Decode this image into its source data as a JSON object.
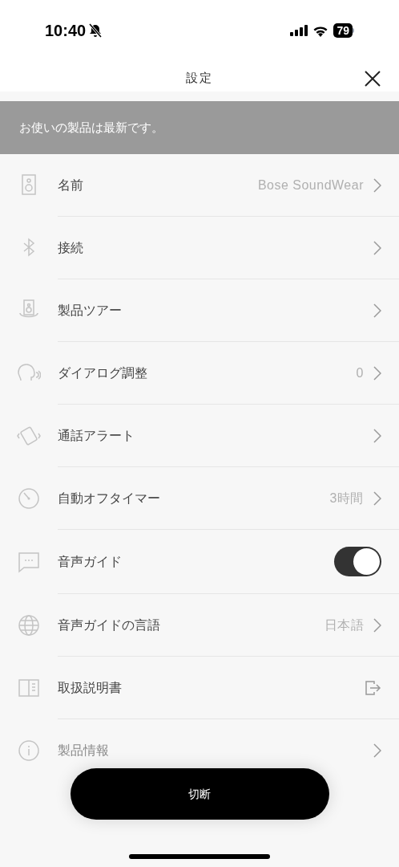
{
  "status_bar": {
    "time": "10:40",
    "battery": "79"
  },
  "header": {
    "title": "設定"
  },
  "banner": {
    "text": "お使いの製品は最新です。"
  },
  "settings": [
    {
      "kind": "link",
      "label": "名前",
      "value": "Bose SoundWear"
    },
    {
      "kind": "link",
      "label": "接続"
    },
    {
      "kind": "link",
      "label": "製品ツアー"
    },
    {
      "kind": "link",
      "label": "ダイアログ調整",
      "value": "0"
    },
    {
      "kind": "link",
      "label": "通話アラート"
    },
    {
      "kind": "link",
      "label": "自動オフタイマー",
      "value": "3時間"
    },
    {
      "kind": "toggle",
      "label": "音声ガイド",
      "on": true
    },
    {
      "kind": "link",
      "label": "音声ガイドの言語",
      "value": "日本語"
    },
    {
      "kind": "external",
      "label": "取扱説明書"
    },
    {
      "kind": "link",
      "label": "製品情報"
    }
  ],
  "disconnect_button": {
    "label": "切断"
  }
}
